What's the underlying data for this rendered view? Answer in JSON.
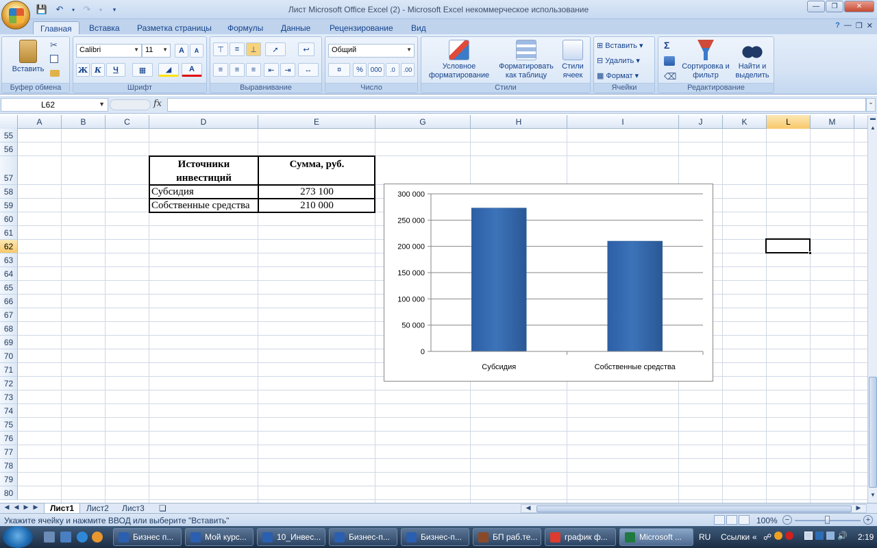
{
  "window": {
    "title": "Лист Microsoft Office Excel (2)  -  Microsoft Excel некоммерческое использование"
  },
  "ribbon": {
    "tabs": [
      "Главная",
      "Вставка",
      "Разметка страницы",
      "Формулы",
      "Данные",
      "Рецензирование",
      "Вид"
    ],
    "groups": {
      "clipboard": {
        "label": "Буфер обмена",
        "paste": "Вставить"
      },
      "font": {
        "label": "Шрифт",
        "family": "Calibri",
        "size": "11",
        "bold": "Ж",
        "italic": "К",
        "underline": "Ч",
        "grow": "A",
        "shrink": "A",
        "fontcolor": "A"
      },
      "alignment": {
        "label": "Выравнивание"
      },
      "number": {
        "label": "Число",
        "format": "Общий",
        "percent": "%",
        "thousands": "000"
      },
      "styles": {
        "label": "Стили",
        "cond_format": "Условное форматирование",
        "as_table": "Форматировать как таблицу",
        "cell_styles": "Стили ячеек"
      },
      "cells": {
        "label": "Ячейки",
        "insert": "Вставить",
        "delete": "Удалить",
        "format": "Формат"
      },
      "editing": {
        "label": "Редактирование",
        "sum": "Σ",
        "sort": "Сортировка и фильтр",
        "find": "Найти и выделить"
      }
    }
  },
  "formula_bar": {
    "name_box": "L62",
    "fx": "fx",
    "value": ""
  },
  "columns": [
    "A",
    "B",
    "C",
    "D",
    "E",
    "G",
    "H",
    "I",
    "J",
    "K",
    "L",
    "M"
  ],
  "rows": [
    "55",
    "56",
    "57",
    "58",
    "59",
    "60",
    "61",
    "62",
    "63",
    "64",
    "65",
    "66",
    "67",
    "68",
    "69",
    "70",
    "71",
    "72",
    "73",
    "74",
    "75",
    "76",
    "77",
    "78",
    "79",
    "80"
  ],
  "selected": {
    "column": "L",
    "row": "62"
  },
  "table": {
    "header_source": "Источники инвестиций",
    "header_sum": "Сумма, руб.",
    "rows": [
      {
        "source": "Субсидия",
        "sum": "273 100"
      },
      {
        "source": "Собственные средства",
        "sum": "210 000"
      }
    ]
  },
  "chart_data": {
    "type": "bar",
    "categories": [
      "Субсидия",
      "Собственные средства"
    ],
    "values": [
      273100,
      210000
    ],
    "ylim": [
      0,
      300000
    ],
    "ytick_labels": [
      "0",
      "50 000",
      "100 000",
      "150 000",
      "200 000",
      "250 000",
      "300 000"
    ],
    "grid": true,
    "legend": "none",
    "bar_color": "#3c73b9"
  },
  "sheets": [
    "Лист1",
    "Лист2",
    "Лист3"
  ],
  "status": {
    "text": "Укажите ячейку и нажмите ВВОД или выберите \"Вставить\"",
    "zoom": "100%"
  },
  "taskbar": {
    "items": [
      "Бизнес п...",
      "Мой курс...",
      "10_Инвес...",
      "Бизнес-п...",
      "Бизнес-п...",
      "БП раб.те...",
      "график ф...",
      "Microsoft ..."
    ],
    "lang": "RU",
    "links": "Ссылки",
    "time": "2:19"
  }
}
